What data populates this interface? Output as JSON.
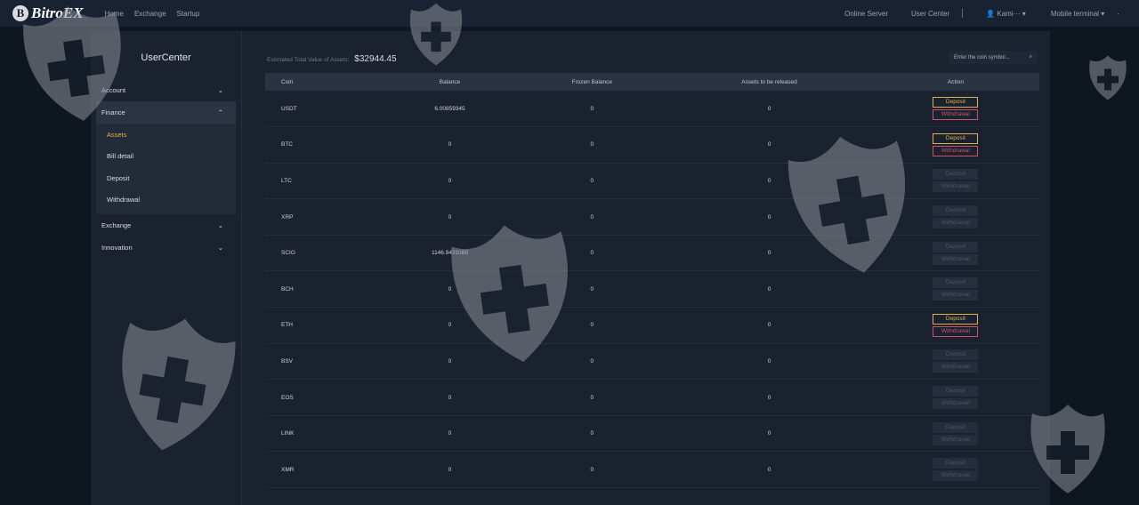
{
  "nav": {
    "brand": "BitroEX",
    "logo_letter": "B",
    "links": [
      "Home",
      "Exchange",
      "Startup"
    ],
    "right": {
      "online_server": "Online Server",
      "user_center": "User Center",
      "user": "Kami···",
      "terminal": "Mobile terminal"
    }
  },
  "sidebar": {
    "title": "UserCenter",
    "items": [
      {
        "label": "Account"
      },
      {
        "label": "Finance",
        "sub": [
          "Assets",
          "Bill detail",
          "Deposit",
          "Withdrawal"
        ]
      },
      {
        "label": "Exchange"
      },
      {
        "label": "Innovation"
      }
    ]
  },
  "summary": {
    "label": "Estimated Total Value of Assets:",
    "value": "$32944.45"
  },
  "search": {
    "placeholder": "Enter the coin symbol..."
  },
  "table": {
    "headers": [
      "Coin",
      "Balance",
      "Frozen Balance",
      "Assets to be released",
      "Action"
    ],
    "deposit_label": "Deposit",
    "withdrawal_label": "Withdrawal",
    "rows": [
      {
        "coin": "USDT",
        "balance": "6.00859345",
        "frozen": "0",
        "release": "0",
        "enabled": true
      },
      {
        "coin": "BTC",
        "balance": "0",
        "frozen": "0",
        "release": "0",
        "enabled": true
      },
      {
        "coin": "LTC",
        "balance": "0",
        "frozen": "0",
        "release": "0",
        "enabled": false
      },
      {
        "coin": "XRP",
        "balance": "0",
        "frozen": "0",
        "release": "0",
        "enabled": false
      },
      {
        "coin": "SCIG",
        "balance": "1146.9431088",
        "frozen": "0",
        "release": "0",
        "enabled": false
      },
      {
        "coin": "BCH",
        "balance": "0",
        "frozen": "0",
        "release": "0",
        "enabled": false
      },
      {
        "coin": "ETH",
        "balance": "0",
        "frozen": "0",
        "release": "0",
        "enabled": true
      },
      {
        "coin": "BSV",
        "balance": "0",
        "frozen": "0",
        "release": "0",
        "enabled": false
      },
      {
        "coin": "EOS",
        "balance": "0",
        "frozen": "0",
        "release": "0",
        "enabled": false
      },
      {
        "coin": "LINK",
        "balance": "0",
        "frozen": "0",
        "release": "0",
        "enabled": false
      },
      {
        "coin": "XMR",
        "balance": "0",
        "frozen": "0",
        "release": "0",
        "enabled": false
      }
    ]
  }
}
